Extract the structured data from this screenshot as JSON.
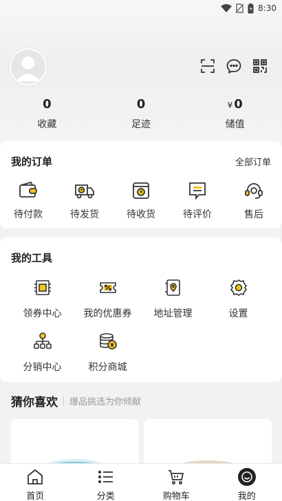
{
  "status_bar": {
    "time": "8:30"
  },
  "stats": [
    {
      "value": "0",
      "label": "收藏"
    },
    {
      "value": "0",
      "label": "足迹"
    },
    {
      "currency": "¥",
      "value": "0",
      "label": "储值"
    }
  ],
  "orders": {
    "title": "我的订单",
    "all_label": "全部订单",
    "items": [
      {
        "label": "待付款",
        "icon": "wallet-icon"
      },
      {
        "label": "待发货",
        "icon": "truck-icon"
      },
      {
        "label": "待收货",
        "icon": "package-clock-icon"
      },
      {
        "label": "待评价",
        "icon": "review-icon"
      },
      {
        "label": "售后",
        "icon": "headset-icon"
      }
    ]
  },
  "tools": {
    "title": "我的工具",
    "items": [
      {
        "label": "领券中心",
        "icon": "ticket-icon"
      },
      {
        "label": "我的优惠券",
        "icon": "coupon-percent-icon"
      },
      {
        "label": "地址管理",
        "icon": "location-icon"
      },
      {
        "label": "设置",
        "icon": "gear-icon"
      },
      {
        "label": "分销中心",
        "icon": "network-icon"
      },
      {
        "label": "积分商城",
        "icon": "coins-icon"
      }
    ]
  },
  "guess": {
    "title": "猜你喜欢",
    "subtitle": "爆品挑选为你倾献"
  },
  "tabbar": [
    {
      "label": "首页",
      "icon": "home-icon"
    },
    {
      "label": "分类",
      "icon": "list-icon"
    },
    {
      "label": "购物车",
      "icon": "cart-icon"
    },
    {
      "label": "我的",
      "icon": "profile-icon"
    }
  ],
  "colors": {
    "accent": "#f5c518",
    "text": "#222222",
    "muted": "#999999"
  }
}
